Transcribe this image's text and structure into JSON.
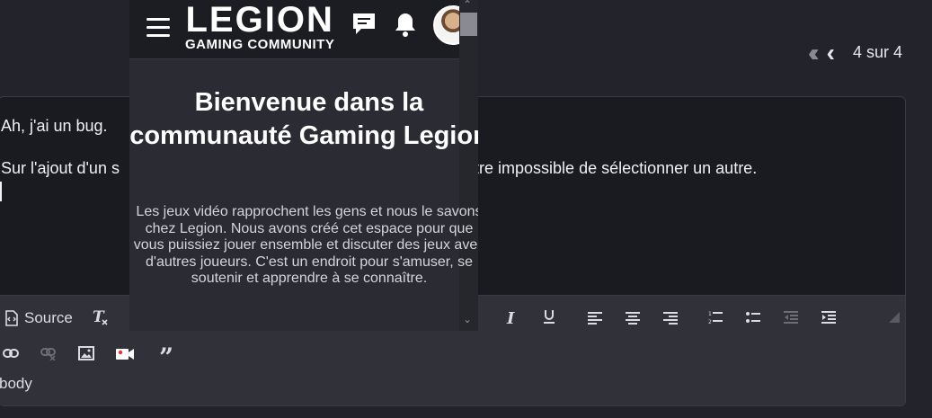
{
  "pager": {
    "count_label": "4 sur 4"
  },
  "editor": {
    "line1": "Ah, j'ai un bug.",
    "line2_left": "Sur l'ajout d'un s",
    "line2_right": "contre impossible de sélectionner un autre.",
    "toolbar": {
      "source_label": "Source"
    },
    "status_path": "body"
  },
  "overlay": {
    "logo_main": "LEGION",
    "logo_sub": "GAMING COMMUNITY",
    "title": "Bienvenue dans la communauté Gaming Legion",
    "description": "Les jeux vidéo rapprochent les gens et nous le savons chez Legion. Nous avons créé cet espace pour que vous puissiez jouer ensemble et discuter des jeux avec d'autres joueurs. C'est un endroit pour s'amuser, se soutenir et apprendre à se connaître."
  },
  "colors": {
    "background": "#23242b",
    "editor_bg": "#1a1b20",
    "toolbar_bg": "#303139",
    "overlay_bg": "#2a2b33",
    "header_bg": "#1c1d22",
    "video_icon": "#e8323c"
  }
}
